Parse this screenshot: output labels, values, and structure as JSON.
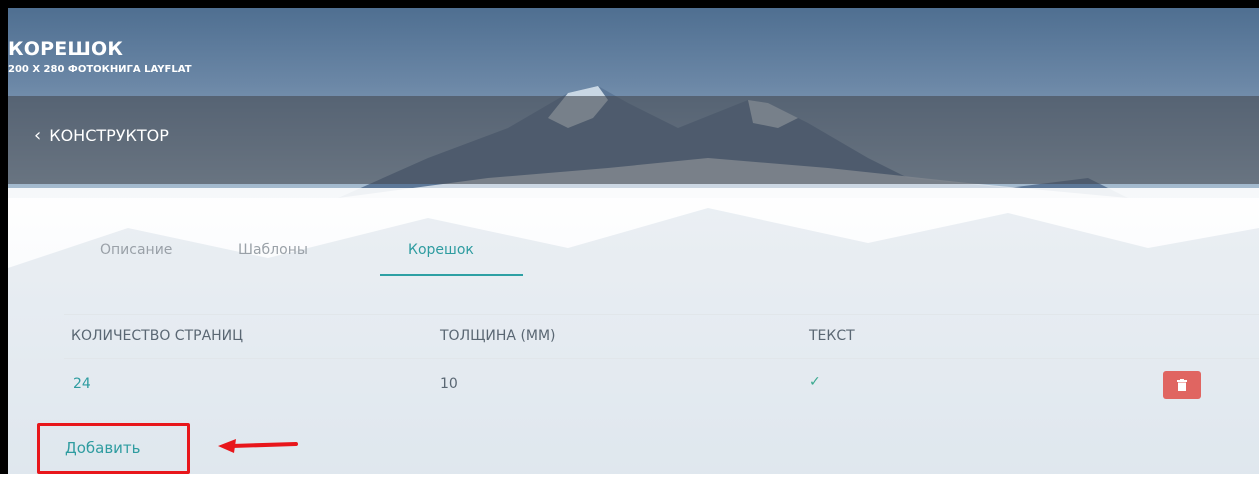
{
  "header": {
    "title": "КОРЕШОК",
    "subtitle": "200 X 280 ФОТОКНИГА LAYFLAT"
  },
  "nav": {
    "back_label": "КОНСТРУКТОР"
  },
  "tabs": [
    {
      "label": "Описание",
      "active": false
    },
    {
      "label": "Шаблоны",
      "active": false
    },
    {
      "label": "Корешок",
      "active": true
    }
  ],
  "table": {
    "columns": [
      "КОЛИЧЕСТВО СТРАНИЦ",
      "ТОЛЩИНА (ММ)",
      "ТЕКСТ"
    ],
    "rows": [
      {
        "pages": "24",
        "thickness": "10",
        "text": "✓"
      }
    ]
  },
  "actions": {
    "add_label": "Добавить"
  },
  "colors": {
    "accent": "#2e9ca0",
    "delete": "#e06561",
    "annotation": "#e8161b"
  },
  "icons": {
    "delete": "trash-icon",
    "back": "chevron-left-icon",
    "check": "check-icon"
  }
}
